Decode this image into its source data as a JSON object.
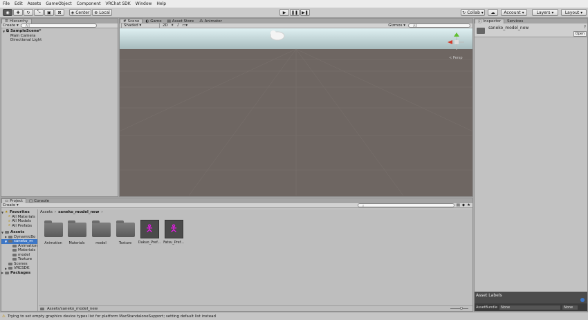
{
  "menu": [
    "File",
    "Edit",
    "Assets",
    "GameObject",
    "Component",
    "VRChat SDK",
    "Window",
    "Help"
  ],
  "toolbar": {
    "pivot_label": "Center",
    "space_label": "Local",
    "collab_label": "Collab",
    "account_label": "Account",
    "layers_label": "Layers",
    "layout_label": "Layout"
  },
  "hierarchy": {
    "tab": "Hierarchy",
    "create_label": "Create",
    "search_placeholder": "All",
    "scene_name": "SampleScene*",
    "items": [
      "Main Camera",
      "Directional Light"
    ]
  },
  "scene": {
    "tabs": [
      "Scene",
      "Game",
      "Asset Store",
      "Animator"
    ],
    "shading": "Shaded",
    "mode_2d": "2D",
    "gizmos_label": "Gizmos",
    "search_placeholder": "All",
    "persp_label": "Persp"
  },
  "inspector": {
    "tabs": [
      "Inspector",
      "Services"
    ],
    "object_name": "saneko_model_new",
    "open_label": "Open",
    "asset_labels_title": "Asset Labels",
    "assetbundle_label": "AssetBundle",
    "assetbundle_value": "None",
    "variant_value": "None"
  },
  "project": {
    "tabs": [
      "Project",
      "Console"
    ],
    "create_label": "Create",
    "favorites_label": "Favorites",
    "favorites": [
      "All Materials",
      "All Models",
      "All Prefabs"
    ],
    "assets_label": "Assets",
    "asset_tree": [
      "DynamicBo",
      "saneko_m",
      "Animation",
      "Materials",
      "model",
      "Texture",
      "Scenes",
      "VRCSDK"
    ],
    "packages_label": "Packages",
    "breadcrumb": [
      "Assets",
      "saneko_model_new"
    ],
    "grid_items": [
      {
        "label": "Animation",
        "kind": "folder"
      },
      {
        "label": "Materials",
        "kind": "folder"
      },
      {
        "label": "model",
        "kind": "folder"
      },
      {
        "label": "Texture",
        "kind": "folder"
      },
      {
        "label": "Dakuo_Pref...",
        "kind": "prefab"
      },
      {
        "label": "Fatsu_Pref...",
        "kind": "prefab"
      }
    ],
    "footer_path": "Assets/saneko_model_new"
  },
  "status": {
    "message": "Trying to set empty graphics device types list for platform MacStandaloneSupport; setting default list instead"
  },
  "colors": {
    "scene_ground": "#6e6662",
    "sky": "#c7dde0",
    "prefab_icon": "#e21be2",
    "selection": "#3d77c7"
  }
}
